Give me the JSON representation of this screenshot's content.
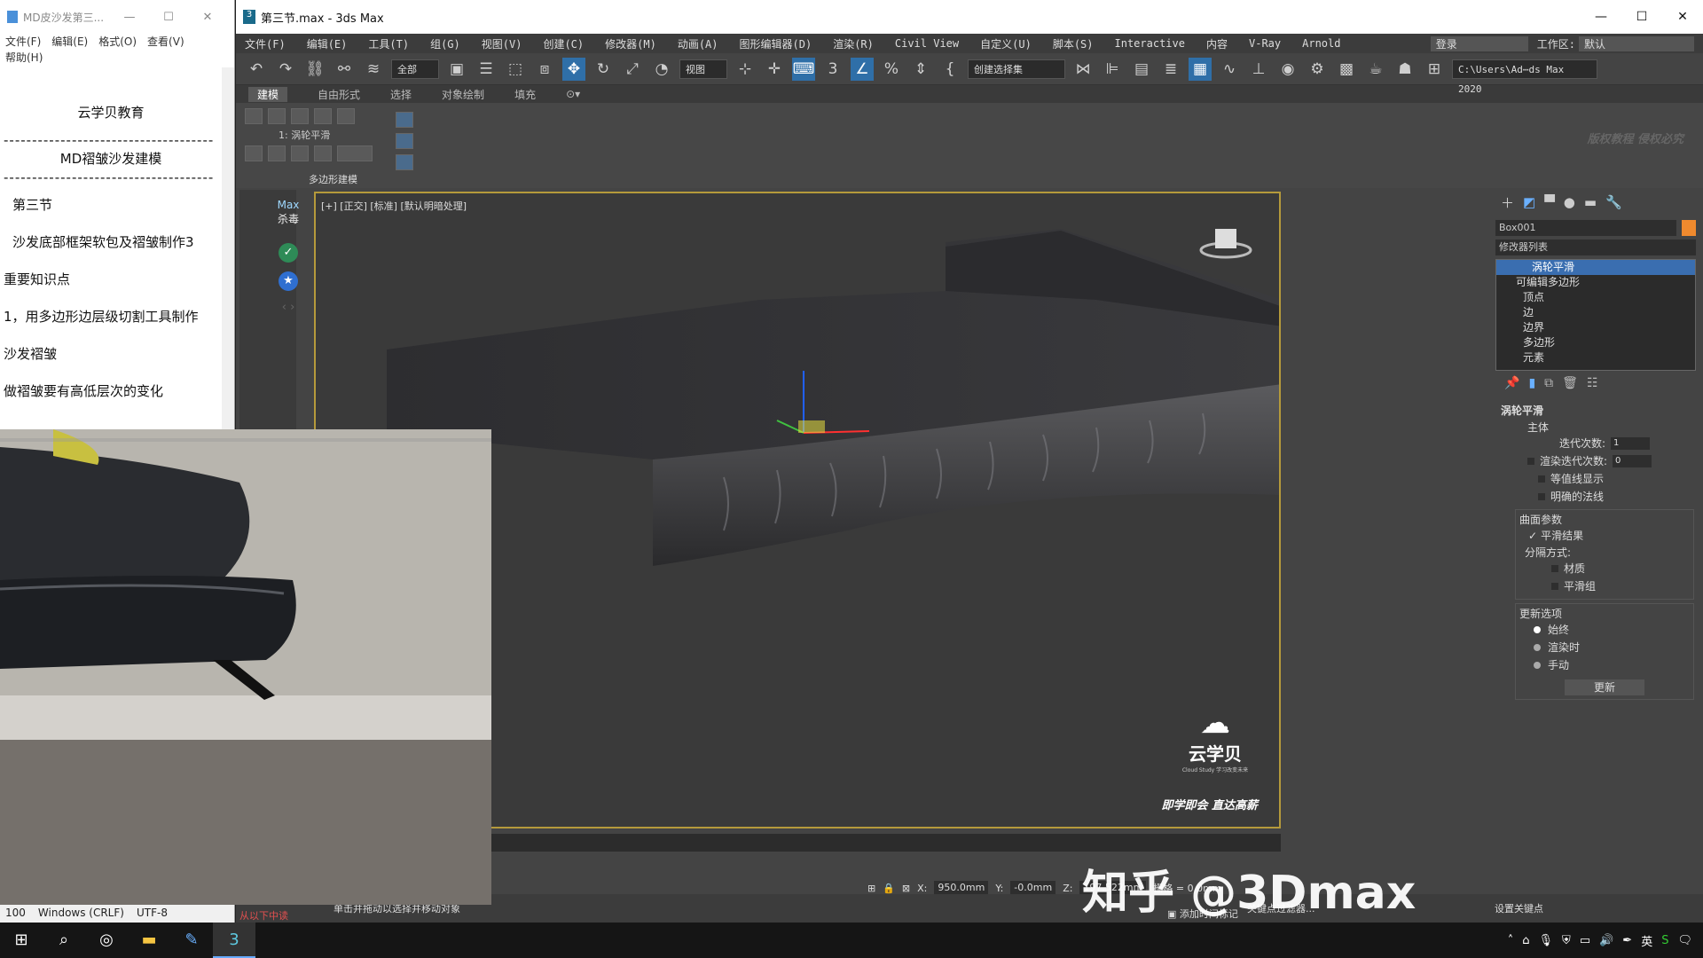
{
  "notepad": {
    "title": "MD皮沙发第三...",
    "menu": [
      "文件(F)",
      "编辑(E)",
      "格式(O)",
      "查看(V)",
      "帮助(H)"
    ],
    "lines": [
      "云学贝教育",
      "------------------------------------------",
      "MD褶皱沙发建模",
      "------------------------------------------",
      "第三节",
      "沙发底部框架软包及褶皱制作3",
      "重要知识点",
      "1，用多边形边层级切割工具制作",
      "沙发褶皱",
      "做褶皱要有高低层次的变化"
    ],
    "status": {
      "pos": "100",
      "eol": "Windows (CRLF)",
      "enc": "UTF-8"
    }
  },
  "max": {
    "title": "第三节.max - 3ds Max",
    "menu": [
      "文件(F)",
      "编辑(E)",
      "工具(T)",
      "组(G)",
      "视图(V)",
      "创建(C)",
      "修改器(M)",
      "动画(A)",
      "图形编辑器(D)",
      "渲染(R)",
      "Civil View",
      "自定义(U)",
      "脚本(S)",
      "Interactive",
      "内容",
      "V-Ray",
      "Arnold"
    ],
    "login": "登录",
    "workspace_label": "工作区:",
    "workspace_value": "默认",
    "toolbar": {
      "filter": "全部",
      "ref_coord": "视图",
      "selection_set": "创建选择集",
      "path": "C:\\Users\\Ad⋯ds Max 2020"
    },
    "ribbon_tabs": [
      "建模",
      "自由形式",
      "选择",
      "对象绘制",
      "填充"
    ],
    "ribbon": {
      "modifier_label": "1: 涡轮平滑",
      "group_label": "多边形建模"
    },
    "watermark_small": "版权教程 侵权必究",
    "left_strip": {
      "max_label": "Max",
      "av_label": "杀毒"
    },
    "viewport": {
      "label": "[+] [正交] [标准] [默认明暗处理]",
      "brand_name": "云学贝",
      "brand_sub": "Cloud Study 学习改变未来",
      "slogan": "即学即会 直达高薪"
    },
    "command_panel": {
      "object_name": "Box001",
      "modifier_list": "修改器列表",
      "stack": [
        "涡轮平滑",
        "可编辑多边形",
        "顶点",
        "边",
        "边界",
        "多边形",
        "元素"
      ],
      "rollout_title": "涡轮平滑",
      "main_label": "主体",
      "iterations_label": "迭代次数:",
      "iterations_value": "1",
      "render_iters_label": "渲染迭代次数:",
      "render_iters_value": "0",
      "isoline": "等值线显示",
      "explicit_normals": "明确的法线",
      "surface_params": "曲面参数",
      "smooth_result": "平滑结果",
      "separate_by": "分隔方式:",
      "materials": "材质",
      "smoothing_groups": "平滑组",
      "update_options": "更新选项",
      "always": "始终",
      "when_rendering": "渲染时",
      "manually": "手动",
      "update_button": "更新"
    },
    "status": {
      "hint": "单击并拖动以选择并移动对象",
      "script_hint": "从以下中读",
      "x_label": "X:",
      "x": "950.0mm",
      "y_label": "Y:",
      "y": "-0.0mm",
      "z_label": "Z:",
      "z": "197.522mm",
      "grid": "栅格 = 0.0mm",
      "add_time_tag": "添加时间标记",
      "set_key": "设置关键点",
      "key_filter": "关键点过滤器..."
    }
  },
  "overlay_watermark": "知乎 @3Dmax",
  "taskbar": {
    "tray": [
      "英"
    ]
  }
}
